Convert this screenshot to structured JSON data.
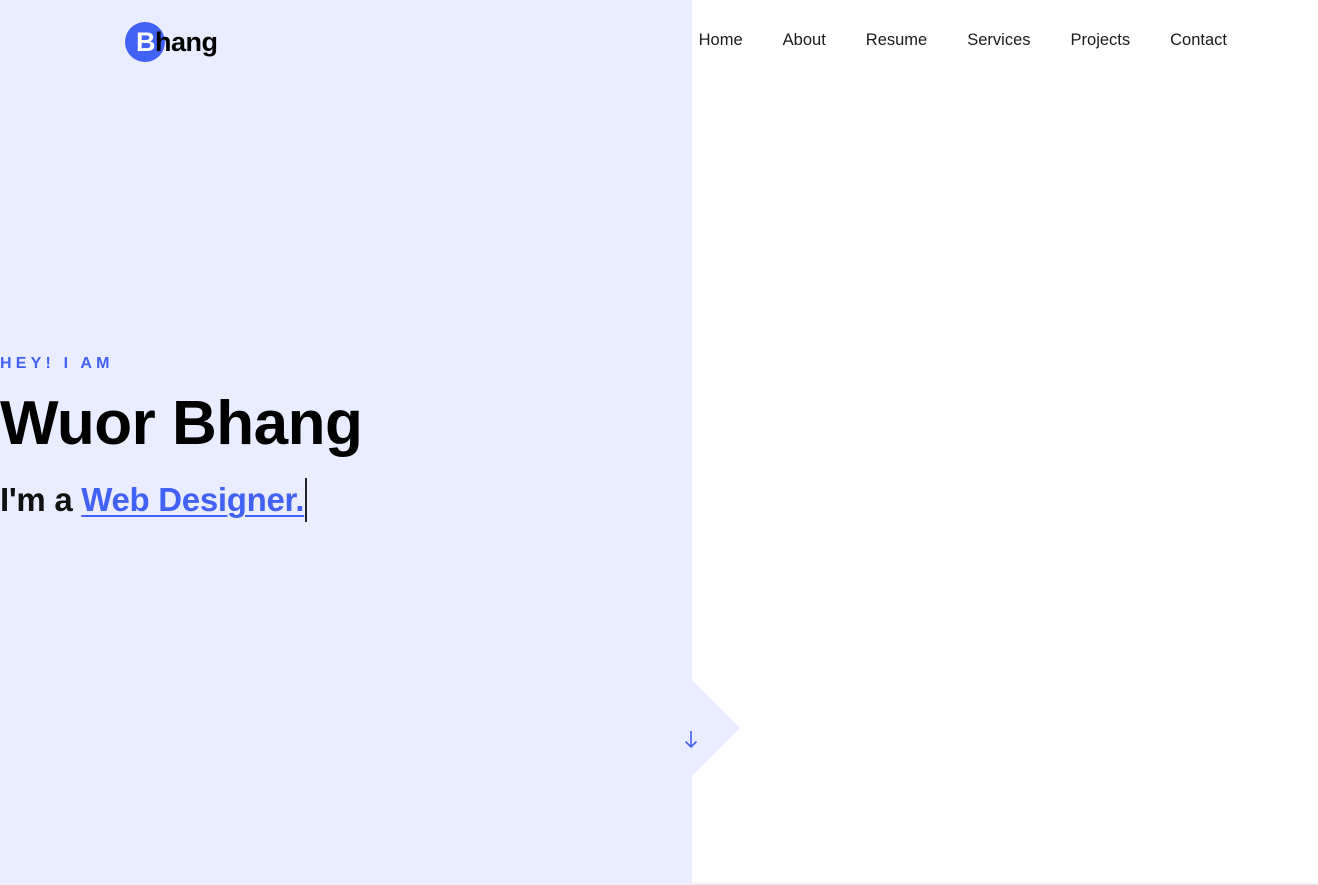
{
  "brand": {
    "logo_first": "B",
    "logo_rest": "hang"
  },
  "nav": {
    "items": [
      {
        "label": "Home"
      },
      {
        "label": "About"
      },
      {
        "label": "Resume"
      },
      {
        "label": "Services"
      },
      {
        "label": "Projects"
      },
      {
        "label": "Contact"
      }
    ]
  },
  "hero": {
    "eyebrow": "HEY! I AM",
    "name": "Wuor Bhang",
    "tagline_prefix": "I'm a ",
    "tagline_role": "Web Designer."
  },
  "scroll": {
    "icon": "arrow-down-icon"
  },
  "colors": {
    "accent": "#4262f6",
    "left_panel": "#eaedff",
    "text": "#000000",
    "background": "#ffffff"
  }
}
